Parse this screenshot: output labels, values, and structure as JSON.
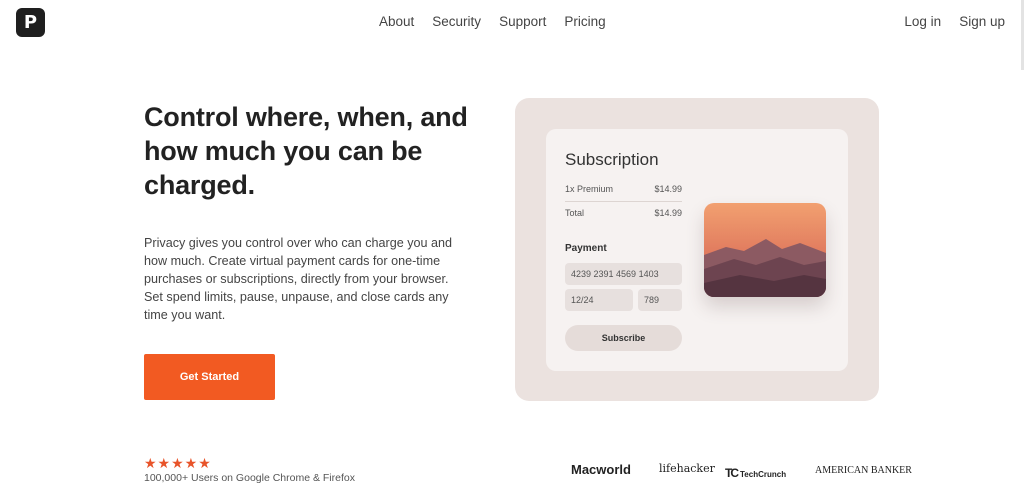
{
  "header": {
    "logo_letter": "P",
    "nav": [
      "About",
      "Security",
      "Support",
      "Pricing"
    ],
    "login": "Log in",
    "signup": "Sign up"
  },
  "hero": {
    "headline": "Control where, when, and how much you can be charged.",
    "description": "Privacy gives you control over who can charge you and how much. Create virtual payment cards for one-time purchases or subscriptions, directly from your browser. Set spend limits, pause, unpause, and close cards any time you want.",
    "cta": "Get Started"
  },
  "mock": {
    "title": "Subscription",
    "item_label": "1x Premium",
    "item_price": "$14.99",
    "total_label": "Total",
    "total_price": "$14.99",
    "payment_label": "Payment",
    "card_number": "4239 2391 4569 1403",
    "expiry": "12/24",
    "cvc": "789",
    "subscribe": "Subscribe"
  },
  "social_proof": {
    "stars": "★★★★★",
    "rating": 4.5,
    "users": "100,000+ Users on Google Chrome & Firefox"
  },
  "press": {
    "macworld": "Macworld",
    "lifehacker": "lifehacker",
    "techcrunch_mark": "TC",
    "techcrunch": "TechCrunch",
    "american_banker": "AMERICAN BANKER"
  },
  "colors": {
    "accent": "#f25a22",
    "mock_bg": "#ebe2df",
    "text": "#222222"
  }
}
